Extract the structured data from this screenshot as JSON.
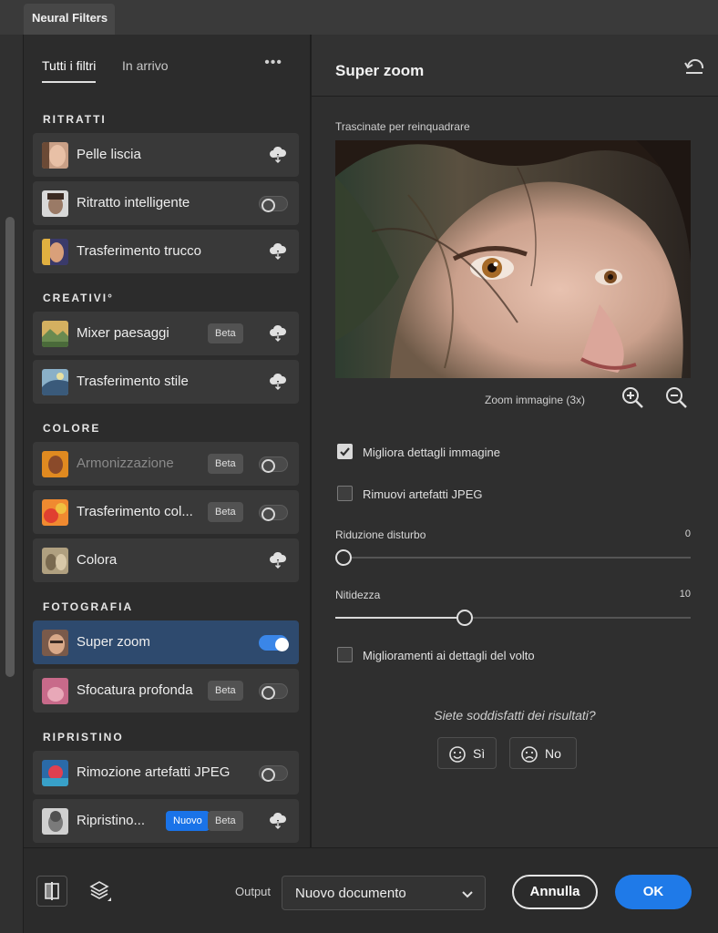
{
  "window": {
    "title": "Neural Filters"
  },
  "tabs": [
    {
      "label": "Tutti i filtri",
      "active": true
    },
    {
      "label": "In arrivo",
      "active": false
    }
  ],
  "more_menu": "•••",
  "sections": [
    {
      "title": "RITRATTI"
    },
    {
      "title": "CREATIVI°"
    },
    {
      "title": "COLORE"
    },
    {
      "title": "FOTOGRAFIA"
    },
    {
      "title": "RIPRISTINO"
    }
  ],
  "filters": [
    {
      "label": "Pelle liscia",
      "control": "download",
      "icon": "cloud-download-icon"
    },
    {
      "label": "Ritratto intelligente",
      "control": "toggle",
      "on": false
    },
    {
      "label": "Trasferimento trucco",
      "control": "download",
      "icon": "cloud-download-icon"
    },
    {
      "label": "Mixer paesaggi",
      "badge": "Beta",
      "control": "download",
      "icon": "cloud-download-icon"
    },
    {
      "label": "Trasferimento stile",
      "control": "download",
      "icon": "cloud-download-icon"
    },
    {
      "label": "Armonizzazione",
      "badge": "Beta",
      "control": "toggle",
      "on": false,
      "disabled": true
    },
    {
      "label": "Trasferimento col...",
      "badge": "Beta",
      "control": "toggle",
      "on": false
    },
    {
      "label": "Colora",
      "control": "download",
      "icon": "cloud-download-icon"
    },
    {
      "label": "Super zoom",
      "control": "toggle",
      "on": true,
      "selected": true
    },
    {
      "label": "Sfocatura profonda",
      "badge": "Beta",
      "control": "toggle",
      "on": false
    },
    {
      "label": "Rimozione artefatti JPEG",
      "control": "toggle",
      "on": false
    },
    {
      "label": "Ripristino...",
      "badges": [
        "Nuovo",
        "Beta"
      ],
      "control": "download",
      "icon": "cloud-download-icon"
    }
  ],
  "panel": {
    "title": "Super zoom",
    "reset_icon": "reset-icon",
    "drag_hint": "Trascinate per reinquadrare",
    "zoom_label": "Zoom immagine (3x)",
    "options": [
      {
        "label": "Migliora dettagli immagine",
        "checked": true
      },
      {
        "label": "Rimuovi artefatti JPEG",
        "checked": false
      }
    ],
    "sliders": [
      {
        "label": "Riduzione disturbo",
        "value": "0",
        "fraction": 0.0
      },
      {
        "label": "Nitidezza",
        "value": "10",
        "fraction": 0.34
      }
    ],
    "face_option": {
      "label": "Miglioramenti ai dettagli del volto",
      "checked": false
    },
    "feedback": {
      "question": "Siete soddisfatti dei risultati?",
      "yes": "Sì",
      "no": "No"
    }
  },
  "footer": {
    "output_label": "Output",
    "output_value": "Nuovo documento",
    "cancel": "Annulla",
    "ok": "OK"
  },
  "colors": {
    "accent": "#1f7ae8",
    "selected_row": "#2e4a6e",
    "new_badge": "#1a73e8"
  }
}
